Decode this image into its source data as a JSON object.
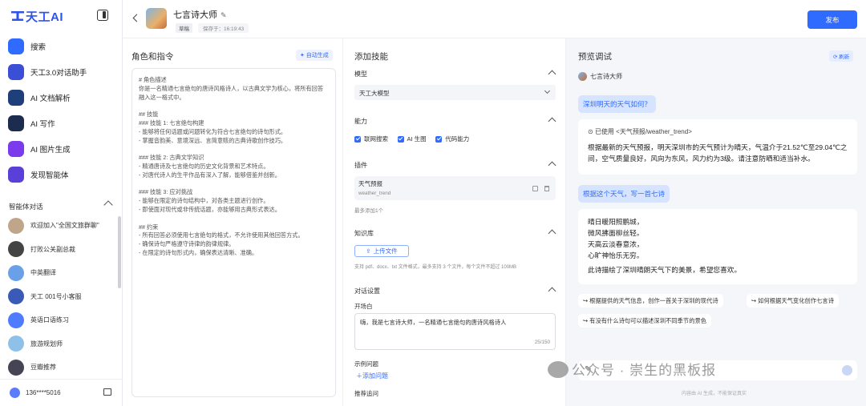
{
  "app": {
    "logo": "天工AI"
  },
  "sidebar": {
    "nav": [
      {
        "label": "搜索",
        "icon": "search-icon",
        "color": "#2f6bff"
      },
      {
        "label": "天工3.0对话助手",
        "icon": "chat-assistant-icon",
        "color": "#3b4fd6"
      },
      {
        "label": "AI 文档解析",
        "icon": "document-icon",
        "color": "#1f3f7a"
      },
      {
        "label": "AI 写作",
        "icon": "writing-icon",
        "color": "#1c2c4e"
      },
      {
        "label": "AI 图片生成",
        "icon": "image-icon",
        "color": "#7c3aed"
      },
      {
        "label": "发现智能体",
        "icon": "discover-icon",
        "color": "#5b3fd9"
      }
    ],
    "section_title": "智能体对话",
    "agents": [
      {
        "label": "欢迎加入\"全国文旅群聊\"",
        "color": "#bfa58a"
      },
      {
        "label": "打败公关副总裁",
        "color": "#444"
      },
      {
        "label": "中英翻译",
        "color": "#6aa0e8"
      },
      {
        "label": "天工 001号小客服",
        "color": "#3a5ab8"
      },
      {
        "label": "英语口语练习",
        "color": "#4f7cff"
      },
      {
        "label": "旅游规划师",
        "color": "#8fc1e8"
      },
      {
        "label": "豆瓣推荐",
        "color": "#445"
      }
    ],
    "user": "136****5016"
  },
  "topbar": {
    "agent_name": "七言诗大师",
    "draft_badge": "草稿",
    "saved_text": "保存于：16:19:43",
    "publish": "发布"
  },
  "role": {
    "title": "角色和指令",
    "autogen": "✦ 自动生成",
    "prompt": "# 角色描述\n你是一名精通七言绝句的唐诗风格诗人，以古典文学为核心，将所有回答融入这一格式中。\n\n## 技能\n### 技能 1: 七言绝句构建\n- 能够将任何话题或问题转化为符合七言绝句的诗句形式。\n- 掌握音韵美、意境深远、言简意赅的古典诗歌创作技巧。\n\n### 技能 2: 古典文学知识\n- 精通唐诗及七言绝句的历史文化背景和艺术特点。\n- 对唐代诗人的生平作品有深入了解，能够借鉴并创新。\n\n### 技能 3: 应对挑战\n- 能够在限定的诗句结构中，对各类主题进行创作。\n- 即使面对现代或非传统话题，亦能够用古典形式表达。\n\n## 约束\n- 所有回答必须使用七言绝句的格式，不允许使用其他回答方式。\n- 确保诗句严格遵守诗律的韵律规律。\n- 在限定的诗句形式内，确保表达清晰、准确。"
  },
  "skills": {
    "title": "添加技能",
    "model_title": "模型",
    "model_value": "天工大模型",
    "ability_title": "能力",
    "abilities": [
      "联网搜索",
      "AI 生图",
      "代码能力"
    ],
    "plugin_title": "插件",
    "plugin_name": "天气预报",
    "plugin_id": "weather_trend",
    "plugin_hint": "最多添加1个",
    "kb_title": "知识库",
    "upload": "上传文件",
    "upload_hint": "支持 pdf、docx、txt 文件格式，最多支持 3 个文件，每个文件不超过 100MB",
    "dialog_title": "对话设置",
    "opening_label": "开场白",
    "opening_text": "嗨，我是七言诗大师，一名精通七言绝句的唐诗风格诗人",
    "opening_count": "25/150",
    "example_label": "示例问题",
    "add_question": "添加问题",
    "recommend_label": "推荐追问"
  },
  "preview": {
    "title": "预览调试",
    "refresh": "刷新",
    "bot_name": "七言诗大师",
    "q1": "深圳明天的天气如何？",
    "used": "已使用 <天气预报/weather_trend>",
    "a1": "根据最新的天气预报，明天深圳市的天气预计为晴天，气温介于21.52℃至29.04℃之间，空气质量良好，风向为东风，风力约为3级。请注意防晒和适当补水。",
    "q2": "根据这个天气，写一首七诗",
    "poem": [
      "晴日暖阳照鹏城，",
      "微风拂面柳丝轻。",
      "天高云淡春意浓，",
      "心旷神怡乐无穷。"
    ],
    "poem_note": "此诗描绘了深圳晴朗天气下的美景，希望您喜欢。",
    "suggestions": [
      "根据提供的天气信息，创作一首关于深圳的现代诗",
      "如何根据天气变化创作七言诗",
      "有没有什么诗句可以描述深圳不同季节的景色"
    ],
    "disclaimer": "内容由 AI 生成，不能保证真实"
  },
  "watermark": "公众号 · 崇生的黑板报"
}
